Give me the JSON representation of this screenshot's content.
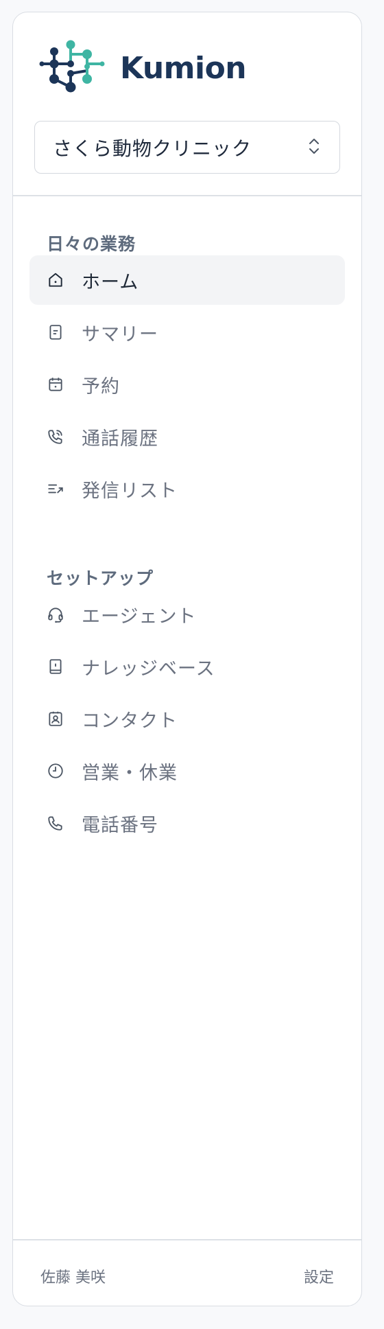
{
  "brand": {
    "name": "Kumion",
    "logo_icon": "molecule-logo-icon",
    "colors": {
      "dark": "#1c3558",
      "teal": "#3fb5a3"
    }
  },
  "clinic_selector": {
    "value": "さくら動物クリニック",
    "icon": "chevron-up-down-icon"
  },
  "sections": [
    {
      "title": "日々の業務",
      "items": [
        {
          "label": "ホーム",
          "icon": "home-icon",
          "active": true
        },
        {
          "label": "サマリー",
          "icon": "document-icon"
        },
        {
          "label": "予約",
          "icon": "calendar-icon"
        },
        {
          "label": "通話履歴",
          "icon": "phone-incoming-icon"
        },
        {
          "label": "発信リスト",
          "icon": "outbound-list-icon"
        }
      ]
    },
    {
      "title": "セットアップ",
      "items": [
        {
          "label": "エージェント",
          "icon": "headset-icon"
        },
        {
          "label": "ナレッジベース",
          "icon": "book-icon"
        },
        {
          "label": "コンタクト",
          "icon": "contact-card-icon"
        },
        {
          "label": "営業・休業",
          "icon": "clock-icon"
        },
        {
          "label": "電話番号",
          "icon": "phone-icon"
        }
      ]
    }
  ],
  "footer": {
    "user_name": "佐藤 美咲",
    "settings_label": "設定"
  }
}
